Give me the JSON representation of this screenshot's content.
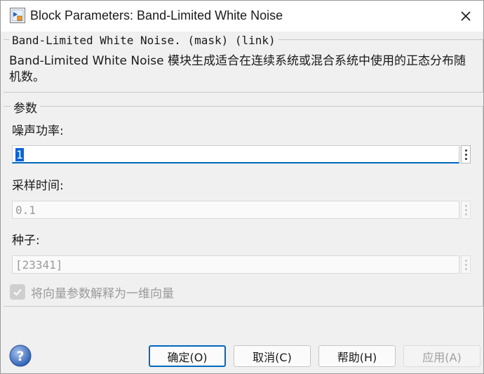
{
  "window": {
    "title": "Block Parameters: Band-Limited White Noise"
  },
  "description": {
    "legend": "Band-Limited White Noise. (mask) (link)",
    "text": "Band-Limited White Noise 模块生成适合在连续系统或混合系统中使用的正态分布随机数。"
  },
  "parameters": {
    "legend": "参数",
    "noise_power": {
      "label": "噪声功率:",
      "value": "1"
    },
    "sample_time": {
      "label": "采样时间:",
      "value": "0.1"
    },
    "seed": {
      "label": "种子:",
      "value": "[23341]"
    },
    "vector_params_checkbox": {
      "label": "将向量参数解释为一维向量",
      "checked": true
    }
  },
  "buttons": {
    "ok": "确定(O)",
    "cancel": "取消(C)",
    "help": "帮助(H)",
    "apply": "应用(A)"
  },
  "colors": {
    "accent": "#0067c0",
    "selection": "#0a64d8"
  }
}
